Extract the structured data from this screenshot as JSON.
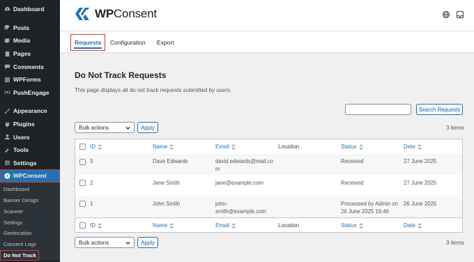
{
  "sidebar": {
    "items": [
      {
        "label": "Dashboard",
        "icon": "dashboard-icon"
      },
      {
        "label": "Posts",
        "icon": "pin-icon"
      },
      {
        "label": "Media",
        "icon": "media-icon"
      },
      {
        "label": "Pages",
        "icon": "pages-icon"
      },
      {
        "label": "Comments",
        "icon": "comment-icon"
      },
      {
        "label": "WPForms",
        "icon": "forms-icon"
      },
      {
        "label": "PushEngage",
        "icon": "broadcast-icon"
      },
      {
        "label": "Appearance",
        "icon": "brush-icon"
      },
      {
        "label": "Plugins",
        "icon": "plugin-icon"
      },
      {
        "label": "Users",
        "icon": "user-icon"
      },
      {
        "label": "Tools",
        "icon": "wrench-icon"
      },
      {
        "label": "Settings",
        "icon": "settings-icon"
      },
      {
        "label": "WPConsent",
        "icon": "wpconsent-icon"
      }
    ],
    "subitems": [
      "Dashboard",
      "Banner Design",
      "Scanner",
      "Settings",
      "Geolocation",
      "Consent Logs",
      "Do Not Track"
    ]
  },
  "header": {
    "logo_bold": "WP",
    "logo_rest": "Consent"
  },
  "tabs": [
    "Requests",
    "Configuration",
    "Export"
  ],
  "main": {
    "title": "Do Not Track Requests",
    "description": "This page displays all do not track requests submitted by users.",
    "search_button": "Search Requests",
    "bulk_actions": "Bulk actions",
    "apply": "Apply",
    "count": "3 items"
  },
  "table": {
    "columns": [
      "ID",
      "Name",
      "Email",
      "Location",
      "Status",
      "Date"
    ],
    "rows": [
      {
        "id": "3",
        "name": "Dave Edwards",
        "email_1": "david.edwards@mail.co",
        "email_2": "m",
        "location": "",
        "status_1": "Received",
        "status_2": "",
        "date": "27 June 2025"
      },
      {
        "id": "2",
        "name": "Jane Smith",
        "email_1": "jane@example.com",
        "email_2": "",
        "location": "",
        "status_1": "Received",
        "status_2": "",
        "date": "27 June 2025"
      },
      {
        "id": "1",
        "name": "John Smith",
        "email_1": "john-",
        "email_2": "smith@example.com",
        "location": "",
        "status_1": "Processed by Admin on",
        "status_2": "26 June 2025 16:46",
        "date": "26 June 2025"
      }
    ]
  },
  "colors": {
    "accent": "#2271b1",
    "sidebar_bg": "#1d2327",
    "highlight": "#d63638"
  }
}
